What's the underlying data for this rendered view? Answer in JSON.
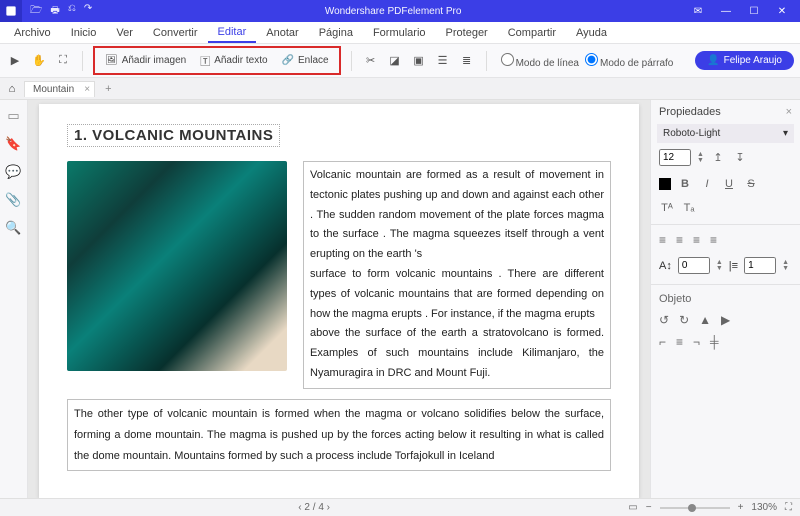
{
  "app": {
    "title": "Wondershare PDFelement Pro"
  },
  "menu": {
    "items": [
      "Archivo",
      "Inicio",
      "Ver",
      "Convertir",
      "Editar",
      "Anotar",
      "Página",
      "Formulario",
      "Proteger",
      "Compartir",
      "Ayuda"
    ],
    "active_index": 4
  },
  "toolbar": {
    "add_image": "Añadir imagen",
    "add_text": "Añadir texto",
    "link": "Enlace",
    "line_mode": "Modo de línea",
    "para_mode": "Modo de párrafo",
    "user": "Felipe Araujo"
  },
  "tabs": {
    "name": "Mountain"
  },
  "doc": {
    "heading": "1. VOLCANIC MOUNTAINS",
    "para1": "Volcanic mountain are formed as a result of movement in tectonic plates pushing up and down and against each other . The sudden random movement of the plate forces magma to the surface . The magma squeezes itself through a vent erupting on the earth 's",
    "para2": "surface to form volcanic mountains . There are different types of volcanic mountains that are formed depending on how the magma erupts . For instance, if the magma erupts",
    "para3": "above the surface of the earth a stratovolcano is formed. Examples of such mountains include Kilimanjaro, the Nyamuragira in DRC and Mount Fuji.",
    "para_full": "The other type of volcanic mountain is formed when the magma or volcano solidifies below the surface, forming a dome mountain. The magma is pushed up by the forces acting below it resulting in what is called the dome mountain. Mountains formed by such a process include Torfajokull in Iceland"
  },
  "props": {
    "title": "Propiedades",
    "font": "Roboto-Light",
    "size": "12",
    "indent_label": "0",
    "spacing_label": "1",
    "object": "Objeto"
  },
  "status": {
    "page": "2",
    "pages": "4",
    "sep": "/",
    "zoom": "130%"
  }
}
